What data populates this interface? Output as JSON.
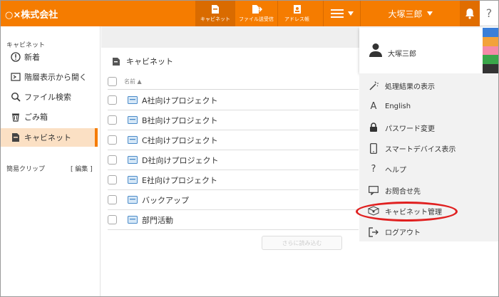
{
  "header": {
    "logo": "○×株式会社",
    "buttons": [
      {
        "label": "キャビネット",
        "icon": "cabinet-icon"
      },
      {
        "label": "ファイル送受信",
        "icon": "file-transfer-icon"
      },
      {
        "label": "アドレス帳",
        "icon": "address-book-icon"
      }
    ],
    "menu_icon": "hamburger-icon",
    "user": "大塚三郎",
    "bell_icon": "bell-icon",
    "help": "?"
  },
  "sidebar": {
    "heading": "キャビネット",
    "items": [
      {
        "label": "新着",
        "icon": "info-circle-icon"
      },
      {
        "label": "階層表示から開く",
        "icon": "tree-view-icon"
      },
      {
        "label": "ファイル検索",
        "icon": "search-icon"
      },
      {
        "label": "ごみ箱",
        "icon": "trash-icon"
      },
      {
        "label": "キャビネット",
        "icon": "cabinet-icon"
      }
    ],
    "clip_label": "簡易クリップ",
    "clip_edit": "[ 編集 ]"
  },
  "main": {
    "title": "キャビネット",
    "column_name": "名前 ▲",
    "rows": [
      "A社向けプロジェクト",
      "B社向けプロジェクト",
      "C社向けプロジェクト",
      "D社向けプロジェクト",
      "E社向けプロジェクト",
      "バックアップ",
      "部門活動"
    ],
    "more_button": "さらに読み込む"
  },
  "dropdown": {
    "user_name": "大塚三郎",
    "colors": [
      "#3a7fd9",
      "#f2a23a",
      "#f48aa8",
      "#3aa64a",
      "#333333"
    ],
    "items": [
      {
        "label": "処理結果の表示",
        "icon": "magic-wand-icon"
      },
      {
        "label": "English",
        "icon": "letter-a-icon",
        "glyph": "A"
      },
      {
        "label": "パスワード変更",
        "icon": "lock-icon"
      },
      {
        "label": "スマートデバイス表示",
        "icon": "smartphone-icon"
      },
      {
        "label": "ヘルプ",
        "icon": "question-icon",
        "glyph": "?"
      },
      {
        "label": "お問合せ先",
        "icon": "chat-icon"
      },
      {
        "label": "キャビネット管理",
        "icon": "cabinet-settings-icon"
      },
      {
        "label": "ログアウト",
        "icon": "logout-icon"
      }
    ]
  }
}
